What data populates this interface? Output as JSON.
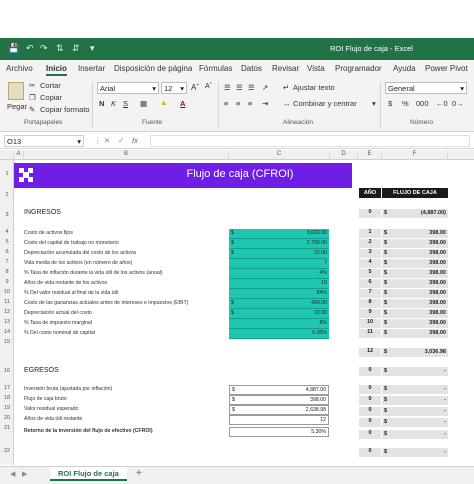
{
  "window": {
    "title": "ROI Flujo de caja  -  Excel"
  },
  "menu": [
    "Archivo",
    "Inicio",
    "Insertar",
    "Disposición de página",
    "Fórmulas",
    "Datos",
    "Revisar",
    "Vista",
    "Programador",
    "Ayuda",
    "Power Pivot"
  ],
  "ribbon": {
    "paste": "Pegar",
    "cut": "Cortar",
    "copy": "Copiar",
    "format_painter": "Copiar formato",
    "font_name": "Arial",
    "font_size": "12",
    "bold": "N",
    "italic": "K",
    "underline": "S",
    "wrap_text": "Ajustar texto",
    "merge_center": "Combinar y centrar",
    "number_format": "General",
    "currency_symbol": "$",
    "percent_symbol": "%",
    "thousands": "000",
    "groups": [
      "Portapapeles",
      "Fuente",
      "Alineación",
      "Número"
    ]
  },
  "formula_bar": {
    "name_box": "O13",
    "cancel": "✕",
    "enter": "✓",
    "fx": "fx",
    "content": ""
  },
  "columns": [
    "A",
    "B",
    "C",
    "D",
    "E",
    "F"
  ],
  "rows": [
    "1",
    "2",
    "3",
    "4",
    "5",
    "6",
    "7",
    "8",
    "9",
    "10",
    "11",
    "12",
    "13",
    "14",
    "15",
    "16",
    "17",
    "18",
    "19",
    "20",
    "21",
    "22"
  ],
  "sheet": {
    "title": "Flujo de caja (CFROI)",
    "ingresos_header": "INGRESOS",
    "egresos_header": "EGRESOS",
    "ingresos": [
      {
        "label": "Costo de activos fijos",
        "cur": "$",
        "value": "3,000.00"
      },
      {
        "label": "Costo del capital de trabajo no monetario",
        "cur": "$",
        "value": "2,700.00"
      },
      {
        "label": "Depreciación acumulada del costo de los activos",
        "cur": "$",
        "value": "22.00"
      },
      {
        "label": "Vida media de los activos (en número de años)",
        "cur": "",
        "value": "7"
      },
      {
        "label": "% Tasa de inflación durante la vida útil de los activos (anual)",
        "cur": "",
        "value": "4%"
      },
      {
        "label": "Años de vida restante de los activos",
        "cur": "",
        "value": "10"
      },
      {
        "label": "% Del valor residual al final de la vida útil",
        "cur": "",
        "value": "54%"
      },
      {
        "label": "Costo de las ganancias actuales antes de intereses e impuestos (EBIT)",
        "cur": "$",
        "value": "400.00"
      },
      {
        "label": "Depreciación actual del costo",
        "cur": "$",
        "value": "10.00"
      },
      {
        "label": "% Tasa de impuesto marginal",
        "cur": "",
        "value": "8%"
      },
      {
        "label": "% Del costo nominal de capital",
        "cur": "",
        "value": "5.00%"
      }
    ],
    "egresos": [
      {
        "label": "Inversión bruta (ajustada por inflación)",
        "cur": "$",
        "value": "4,887.00"
      },
      {
        "label": "Flujo de caja bruto",
        "cur": "$",
        "value": "398.00"
      },
      {
        "label": "Valor residual esperado",
        "cur": "$",
        "value": "2,638.98"
      },
      {
        "label": "Años de vida útil restante",
        "cur": "",
        "value": "12"
      }
    ],
    "result": {
      "label": "Retorno de la inversión del flujo de efectivo (CFROI)",
      "value": "5.30%"
    },
    "table_headers": {
      "year": "AÑO",
      "cashflow": "FLUJO DE CAJA"
    },
    "table": [
      {
        "year": "0",
        "cur": "$",
        "value": "(4,887.00)"
      },
      {
        "year": "1",
        "cur": "$",
        "value": "398.00"
      },
      {
        "year": "2",
        "cur": "$",
        "value": "398.00"
      },
      {
        "year": "3",
        "cur": "$",
        "value": "398.00"
      },
      {
        "year": "4",
        "cur": "$",
        "value": "398.00"
      },
      {
        "year": "5",
        "cur": "$",
        "value": "398.00"
      },
      {
        "year": "6",
        "cur": "$",
        "value": "398.00"
      },
      {
        "year": "7",
        "cur": "$",
        "value": "398.00"
      },
      {
        "year": "8",
        "cur": "$",
        "value": "398.00"
      },
      {
        "year": "9",
        "cur": "$",
        "value": "398.00"
      },
      {
        "year": "10",
        "cur": "$",
        "value": "398.00"
      },
      {
        "year": "11",
        "cur": "$",
        "value": "398.00"
      },
      {
        "year": "12",
        "cur": "$",
        "value": "3,036.98"
      },
      {
        "year": "0",
        "cur": "$",
        "value": "-"
      },
      {
        "year": "0",
        "cur": "$",
        "value": "-"
      },
      {
        "year": "0",
        "cur": "$",
        "value": "-"
      },
      {
        "year": "0",
        "cur": "$",
        "value": "-"
      },
      {
        "year": "0",
        "cur": "$",
        "value": "-"
      },
      {
        "year": "0",
        "cur": "$",
        "value": "-"
      },
      {
        "year": "0",
        "cur": "$",
        "value": "-"
      }
    ]
  },
  "tabs": {
    "active": "ROI Flujo de caja",
    "add": "+"
  },
  "colors": {
    "excel_green": "#217346",
    "banner": "#6f1ee6",
    "input_teal": "#20c7b0"
  }
}
